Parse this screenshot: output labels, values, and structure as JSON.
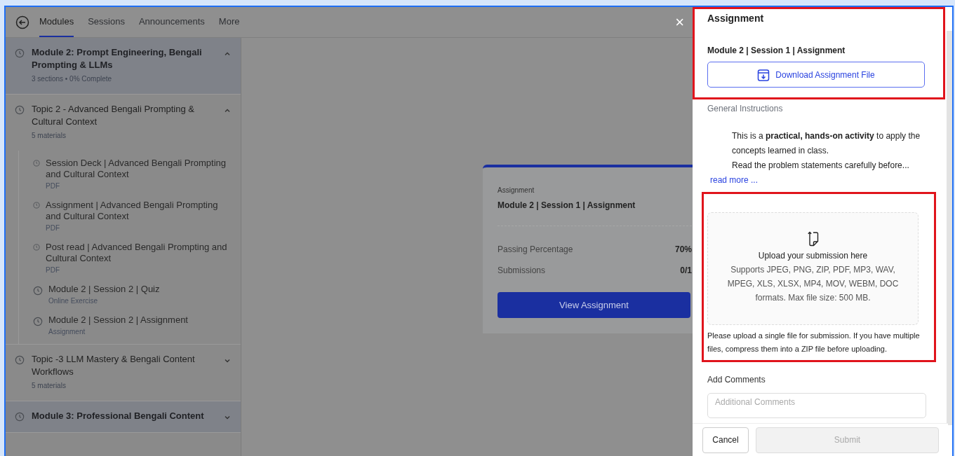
{
  "nav": {
    "tabs": [
      {
        "label": "Modules",
        "selected": true
      },
      {
        "label": "Sessions",
        "selected": false
      },
      {
        "label": "Announcements",
        "selected": false
      },
      {
        "label": "More",
        "selected": false
      }
    ]
  },
  "sidebar": {
    "modules": [
      {
        "title": "Module 2: Prompt Engineering, Bengali Prompting & LLMs",
        "meta": "3 sections • 0% Complete",
        "expanded": true,
        "children": [
          {
            "title": "Topic 2 - Advanced Bengali Prompting & Cultural Context",
            "meta": "5 materials",
            "expanded": true,
            "children": [
              {
                "title": "Session Deck | Advanced Bengali Prompting and Cultural Context",
                "type": "PDF",
                "kind": "file"
              },
              {
                "title": "Assignment | Advanced Bengali Prompting and Cultural Context",
                "type": "PDF",
                "kind": "file"
              },
              {
                "title": "Post read | Advanced Bengali Prompting and Cultural Context",
                "type": "PDF",
                "kind": "file"
              },
              {
                "title": "Module 2 | Session 2 | Quiz",
                "type": "Online Exercise",
                "kind": "activity"
              },
              {
                "title": "Module 2 | Session 2 | Assignment",
                "type": "Assignment",
                "kind": "activity"
              }
            ]
          },
          {
            "title": "Topic -3 LLM Mastery & Bengali Content Workflows",
            "meta": "5 materials",
            "expanded": false
          }
        ]
      },
      {
        "title": "Module 3: Professional Bengali Content",
        "expanded": false
      }
    ]
  },
  "card": {
    "label": "Assignment",
    "title": "Module 2 | Session 1 | Assignment",
    "stats": [
      {
        "label": "Passing Percentage",
        "value": "70%"
      },
      {
        "label": "Submissions",
        "value": "0/1"
      }
    ],
    "button": "View Assignment"
  },
  "close": "×",
  "drawer": {
    "heading": "Assignment",
    "assignment_title": "Module 2 | Session 1 | Assignment",
    "download_button": "Download Assignment File",
    "instructions_label": "General Instructions",
    "instructions": [
      "This is a **practical, hands-on activity** to apply the concepts learned in class.",
      "Read the problem statements carefully before..."
    ],
    "read_more": "read more ...",
    "upload": {
      "title": "Upload your submission here",
      "formats": "Supports JPEG, PNG, ZIP, PDF, MP3, WAV, MPEG, XLS, XLSX, MP4, MOV, WEBM, DOC formats. Max file size: 500 MB."
    },
    "note": "Please upload a single file for submission. If you have multiple files, compress them into a ZIP file before uploading.",
    "comments_label": "Add Comments",
    "comments_placeholder": "Additional Comments",
    "cancel": "Cancel",
    "submit": {
      "label": "Submit",
      "disabled": true
    }
  }
}
